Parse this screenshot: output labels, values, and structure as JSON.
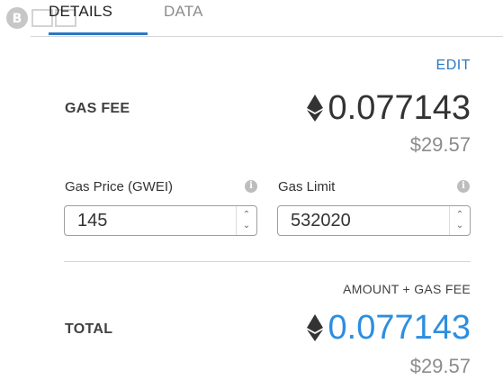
{
  "tabs": {
    "details": "DETAILS",
    "data": "DATA"
  },
  "edit_label": "EDIT",
  "gas_fee": {
    "label": "GAS FEE",
    "eth_amount": "0.077143",
    "usd_amount": "$29.57"
  },
  "gas_price": {
    "label": "Gas Price (GWEI)",
    "value": "145"
  },
  "gas_limit": {
    "label": "Gas Limit",
    "value": "532020"
  },
  "summary": {
    "subtitle": "AMOUNT + GAS FEE",
    "total_label": "TOTAL",
    "eth_amount": "0.077143",
    "usd_amount": "$29.57"
  },
  "icons": {
    "currency": "ethereum-icon",
    "info": "info-icon",
    "stepper": "chevron-up-down-icon"
  },
  "colors": {
    "accent": "#2b78c5",
    "total": "#2d8ee0",
    "muted": "#8c8c8c"
  }
}
